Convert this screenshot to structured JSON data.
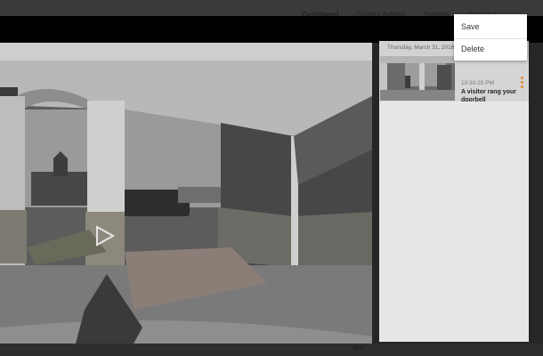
{
  "header": {
    "nav": [
      "Dashboard",
      "Custom Actions",
      "Settings",
      "Sign Out"
    ]
  },
  "player": {
    "play_icon": "play-icon"
  },
  "side_panel": {
    "date": "Thursday, March 31, 2016",
    "event": {
      "time": "10:30:20 PM",
      "description": "A visitor rang your doorbell"
    },
    "menu_icon": "kebab-menu-icon"
  },
  "dropdown": {
    "items": [
      "Save",
      "Delete"
    ]
  },
  "background_thumb": {
    "text": "75.0°"
  },
  "colors": {
    "accent": "#e08a2e",
    "panel": "#e6e6e6"
  }
}
